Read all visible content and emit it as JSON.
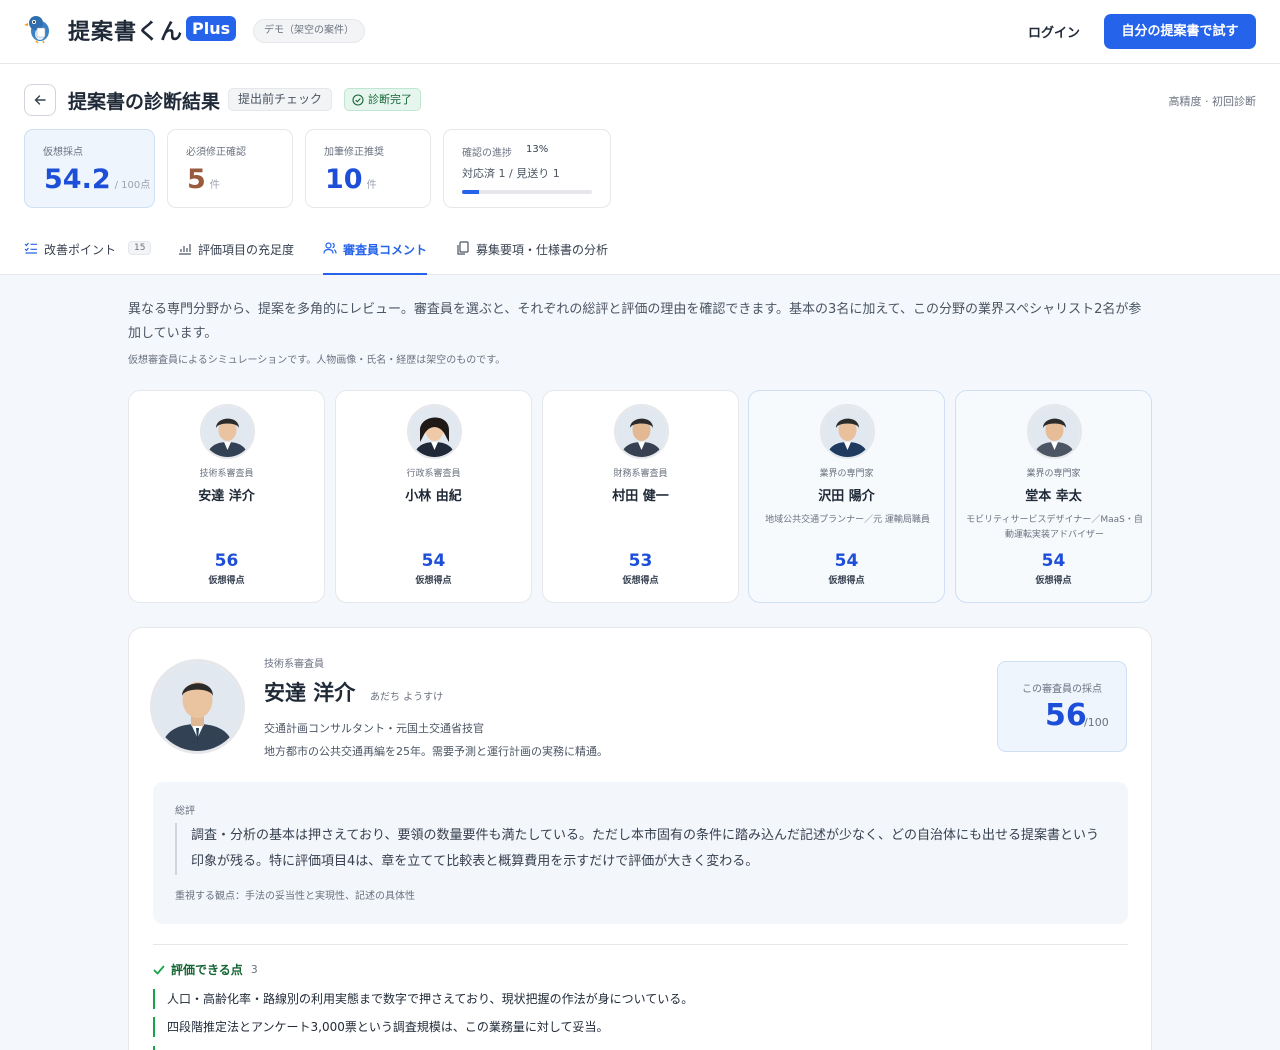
{
  "brand": {
    "name": "提案書くん",
    "plus": "Plus",
    "demo_label": "デモ（架空の案件）"
  },
  "nav": {
    "login": "ログイン",
    "try_button": "自分の提案書で試す"
  },
  "header": {
    "title": "提案書の診断結果",
    "check_badge": "提出前チェック",
    "done_badge": "診断完了",
    "mode": "高精度 · 初回診断"
  },
  "stats": {
    "score": {
      "label": "仮想採点",
      "value": "54.2",
      "unit": "/ 100点"
    },
    "required": {
      "label": "必須修正確認",
      "value": "5",
      "unit": "件"
    },
    "recommended": {
      "label": "加筆修正推奨",
      "value": "10",
      "unit": "件"
    },
    "progress": {
      "label": "確認の進捗",
      "percent_text": "13%",
      "detail": "対応済 1 / 見送り 1",
      "fraction": 0.13
    }
  },
  "tabs": [
    {
      "label": "改善ポイント",
      "count": "15"
    },
    {
      "label": "評価項目の充足度"
    },
    {
      "label": "審査員コメント"
    },
    {
      "label": "募集要項・仕様書の分析"
    }
  ],
  "intro": {
    "text": "異なる専門分野から、提案を多角的にレビュー。審査員を選ぶと、それぞれの総評と評価の理由を確認できます。基本の3名に加えて、この分野の業界スペシャリスト2名が参加しています。",
    "note": "仮想審査員によるシミュレーションです。人物画像・氏名・経歴は架空のものです。"
  },
  "score_label": "仮想得点",
  "reviewers": [
    {
      "role": "技術系審査員",
      "name": "安達 洋介",
      "desc": "",
      "score": "56"
    },
    {
      "role": "行政系審査員",
      "name": "小林 由紀",
      "desc": "",
      "score": "54"
    },
    {
      "role": "財務系審査員",
      "name": "村田 健一",
      "desc": "",
      "score": "53"
    },
    {
      "role": "業界の専門家",
      "name": "沢田 陽介",
      "desc": "地域公共交通プランナー／元 運輸局職員",
      "score": "54"
    },
    {
      "role": "業界の専門家",
      "name": "堂本 幸太",
      "desc": "モビリティサービスデザイナー／MaaS・自動運転実装アドバイザー",
      "score": "54"
    }
  ],
  "detail": {
    "role": "技術系審査員",
    "name": "安達 洋介",
    "kana": "あだち ようすけ",
    "title": "交通計画コンサルタント・元国土交通省技官",
    "bio": "地方都市の公共交通再編を25年。需要予測と運行計画の実務に精通。",
    "score_label": "この審査員の採点",
    "score": "56",
    "score_max": "/100",
    "summary_label": "総評",
    "summary": "調査・分析の基本は押さえており、要領の数量要件も満たしている。ただし本市固有の条件に踏み込んだ記述が少なく、どの自治体にも出せる提案書という印象が残る。特に評価項目4は、章を立てて比較表と概算費用を示すだけで評価が大きく変わる。",
    "focus": "重視する観点：手法の妥当性と実現性、記述の具体性",
    "good_header": "評価できる点",
    "good_count": "3",
    "good_points": [
      "人口・高齢化率・路線別の利用実態まで数字で押さえており、現状把握の作法が身についている。",
      "四段階推定法とアンケート3,000票という調査規模は、この業務量に対して妥当。",
      ""
    ]
  }
}
